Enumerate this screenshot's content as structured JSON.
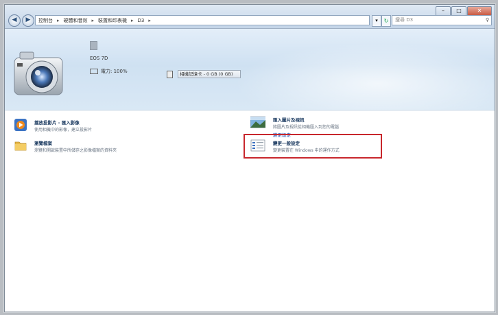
{
  "window": {
    "title_buttons": [
      "minimize-icon",
      "maximize-icon",
      "close-icon"
    ]
  },
  "nav": {
    "back_icon": "back-arrow-icon",
    "forward_icon": "forward-arrow-icon"
  },
  "address_bar": {
    "crumbs": [
      "控制台",
      "硬體和音效",
      "裝置和印表機",
      "D3"
    ],
    "dropdown_icon": "chevron-down-icon",
    "refresh_icon": "refresh-icon"
  },
  "search": {
    "placeholder": "搜尋 D3",
    "icon": "search-icon"
  },
  "device": {
    "model": "EOS 7D",
    "battery": "電力: 100%",
    "storage": "相機記憶卡 - 0 GB (0 GB)"
  },
  "tasks": [
    {
      "title": "播放投影片 - 匯入影像",
      "desc": "使用相機中的影像，建立投影片",
      "icon": "media-player-icon"
    },
    {
      "title": "瀏覽檔案",
      "desc": "瀏覽和開啟裝置中所儲存之影像檔案的資料夾",
      "icon": "folder-icon"
    },
    {
      "title": "匯入圖片及視訊",
      "desc": "將圖片及視訊從相機匯入到您的電腦",
      "link": "變更設定",
      "icon": "photo-import-icon"
    },
    {
      "title": "變更一般設定",
      "desc": "變更裝置在 Windows 中的運作方式",
      "icon": "settings-document-icon"
    }
  ],
  "colors": {
    "highlight": "#c8262c",
    "header_bg": "#cfe1f2"
  }
}
